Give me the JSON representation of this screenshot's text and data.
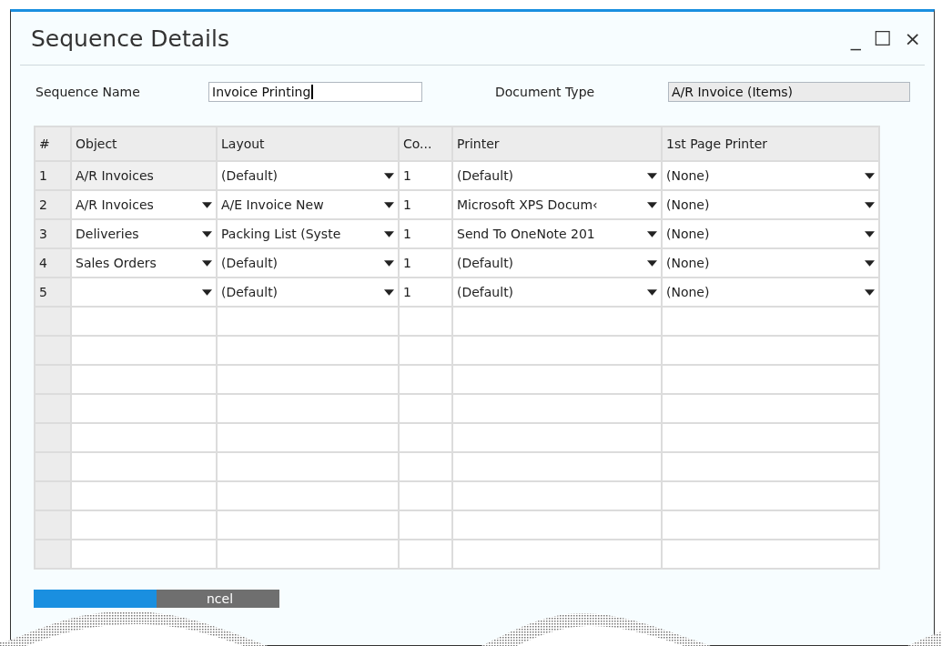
{
  "window": {
    "title": "Sequence Details",
    "controls": [
      "_",
      "☐",
      "×"
    ]
  },
  "fields": [
    {
      "label": "Sequence Name",
      "value": "Invoice Printing",
      "disabled": false
    },
    {
      "label": "Document Type",
      "value": "A/R Invoice (Items)",
      "disabled": true
    }
  ],
  "table": {
    "columns": [
      "#",
      "Object",
      "Layout",
      "Co...",
      "Printer",
      "1st Page Printer"
    ],
    "rows": [
      {
        "number": "1",
        "object": {
          "text": "A/R Invoices",
          "editable": false
        },
        "layout": "(Default)",
        "copies": "1",
        "printer": "(Default)",
        "first_page_printer": "(None)"
      },
      {
        "number": "2",
        "object": {
          "text": "A/R Invoices",
          "editable": true
        },
        "layout": "A/E Invoice New",
        "copies": "1",
        "printer": "Microsoft XPS Docum‹",
        "first_page_printer": "(None)"
      },
      {
        "number": "3",
        "object": {
          "text": "Deliveries",
          "editable": true
        },
        "layout": "Packing List (Syste",
        "copies": "1",
        "printer": "Send To OneNote 201",
        "first_page_printer": "(None)"
      },
      {
        "number": "4",
        "object": {
          "text": "Sales Orders",
          "editable": true
        },
        "layout": "(Default)",
        "copies": "1",
        "printer": "(Default)",
        "first_page_printer": "(None)"
      },
      {
        "number": "5",
        "object": {
          "editable": true
        },
        "layout": "(Default)",
        "copies": "1",
        "printer": "(Default)",
        "first_page_printer": "(None)"
      }
    ]
  },
  "buttons": [
    {
      "kind": "primary"
    },
    {
      "kind": "secondary",
      "label": "ncel"
    }
  ]
}
